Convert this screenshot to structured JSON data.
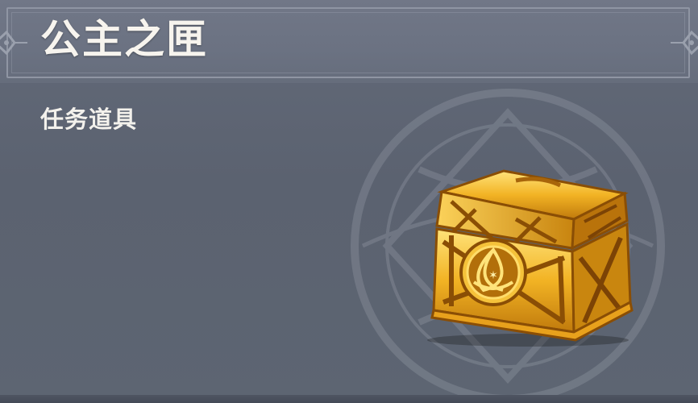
{
  "item": {
    "name": "公主之匣",
    "category": "任务道具",
    "icon": "golden-treasure-chest-icon"
  },
  "colors": {
    "header_bg": "#6b7282",
    "body_bg": "#5d6572",
    "text": "#f7f4ee",
    "chest_gold": "#e0a418"
  }
}
